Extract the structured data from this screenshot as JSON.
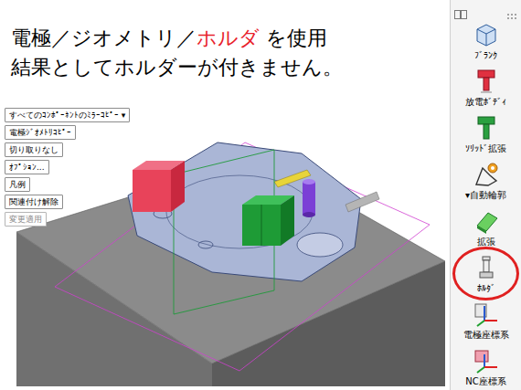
{
  "heading": {
    "line1": [
      {
        "text": "電極／ジオメトリ／",
        "color": "#000000"
      },
      {
        "text": "ホルダ",
        "color": "#e8202a"
      },
      {
        "text": " を使用",
        "color": "#000000"
      }
    ],
    "line2": "結果としてホルダーが付きません。"
  },
  "buttons": [
    {
      "label": "すべてのｺﾝﾎﾟｰﾈﾝﾄのﾐﾗｰｺﾋﾟｰ ▾",
      "disabled": false
    },
    {
      "label": "電極ｼﾞｵﾒﾄﾘｺﾋﾟｰ",
      "disabled": false
    },
    {
      "label": "切り取りなし",
      "disabled": false
    },
    {
      "label": "ｵﾌﾟｼｮﾝ...",
      "disabled": false
    },
    {
      "label": "凡例",
      "disabled": false
    },
    {
      "label": "関連付け解除",
      "disabled": false
    },
    {
      "label": "変更適用",
      "disabled": true
    }
  ],
  "toolbar": {
    "items": [
      {
        "label": "ﾌﾞﾗﾝｸ",
        "highlighted": false
      },
      {
        "label": "放電ﾎﾞﾃﾞｨ",
        "highlighted": false
      },
      {
        "label": "ｿﾘｯﾄﾞ拡張",
        "highlighted": false
      },
      {
        "label": "▾自動輪郭",
        "highlighted": false
      },
      {
        "label": "拡張",
        "highlighted": false
      },
      {
        "label": "ﾎﾙﾀﾞ",
        "highlighted": true
      },
      {
        "label": "電極座標系",
        "highlighted": false
      },
      {
        "label": "NC座標系",
        "highlighted": false
      }
    ]
  }
}
